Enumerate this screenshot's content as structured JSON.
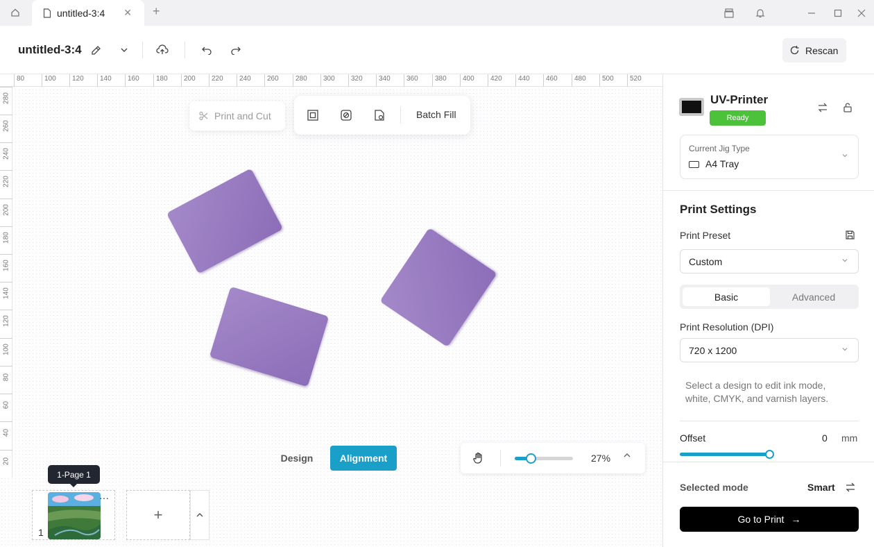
{
  "tabbar": {
    "tab_title": "untitled-3:4",
    "tab_close": "✕",
    "new_tab": "+"
  },
  "toolbar": {
    "doc_title": "untitled-3:4",
    "rescan_label": "Rescan"
  },
  "rulers": {
    "top": [
      "80",
      "100",
      "120",
      "140",
      "160",
      "180",
      "200",
      "220",
      "240",
      "260",
      "280",
      "300",
      "320",
      "340",
      "360",
      "380",
      "400",
      "420",
      "440",
      "460",
      "480",
      "500",
      "520"
    ],
    "left": [
      "280",
      "260",
      "240",
      "220",
      "200",
      "180",
      "160",
      "140",
      "120",
      "100",
      "80",
      "60",
      "40",
      "20"
    ]
  },
  "canvas": {
    "print_and_cut_label": "Print and Cut",
    "batch_fill_label": "Batch Fill",
    "shape_color": "#9b7fc2"
  },
  "modes": {
    "design_label": "Design",
    "alignment_label": "Alignment",
    "active": "Alignment",
    "accent": "#1a9fc9"
  },
  "zoom": {
    "percent_label": "27%",
    "slider_value": 0.27
  },
  "pages": {
    "tooltip": "1-Page 1",
    "page_number": "1",
    "more": "···",
    "add_label": "+"
  },
  "printer": {
    "name": "UV-Printer",
    "status": "Ready",
    "status_color": "#4cc13a"
  },
  "jig": {
    "label": "Current Jig Type",
    "value": "A4 Tray"
  },
  "print_settings": {
    "title": "Print Settings",
    "preset_label": "Print Preset",
    "preset_value": "Custom",
    "tabs": [
      "Basic",
      "Advanced"
    ],
    "active_tab": "Basic",
    "resolution_label": "Print Resolution (DPI)",
    "resolution_value": "720 x 1200",
    "hint": "Select a design to edit ink mode, white, CMYK, and varnish layers.",
    "offset_label": "Offset",
    "offset_value": "0",
    "offset_unit": "mm"
  },
  "footer": {
    "selected_mode_label": "Selected mode",
    "selected_mode_value": "Smart",
    "go_print_label": "Go to Print",
    "go_print_arrow": "→"
  }
}
